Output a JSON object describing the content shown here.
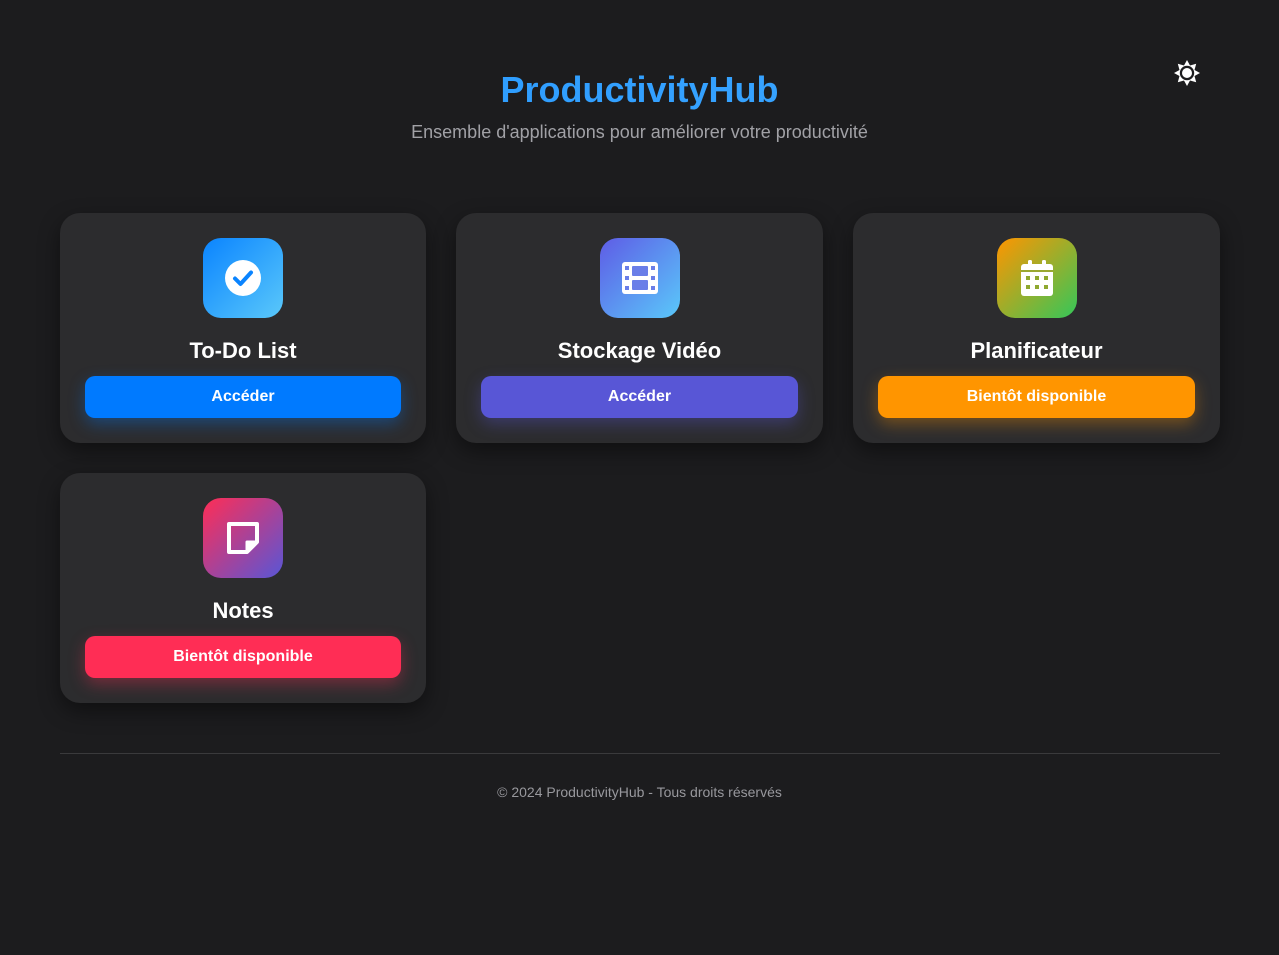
{
  "app": {
    "title": "ProductivityHub",
    "subtitle": "Ensemble d'applications pour améliorer votre productivité"
  },
  "theme_toggle": {
    "icon": "sun-icon"
  },
  "cards": [
    {
      "title": "To-Do List",
      "button_label": "Accéder",
      "icon": "check-circle-icon",
      "icon_gradient": [
        "#0a84ff",
        "#5ac8fa"
      ],
      "button_color": "#007aff"
    },
    {
      "title": "Stockage Vidéo",
      "button_label": "Accéder",
      "icon": "film-icon",
      "icon_gradient": [
        "#5e5ce6",
        "#5ac8fa"
      ],
      "button_color": "#5856d6"
    },
    {
      "title": "Planificateur",
      "button_label": "Bientôt disponible",
      "icon": "calendar-icon",
      "icon_gradient": [
        "#ff9500",
        "#34c759"
      ],
      "button_color": "#ff9500"
    },
    {
      "title": "Notes",
      "button_label": "Bientôt disponible",
      "icon": "sticky-note-icon",
      "icon_gradient": [
        "#ff2d55",
        "#5856d6"
      ],
      "button_color": "#ff2d55"
    }
  ],
  "footer": {
    "text": "© 2024 ProductivityHub - Tous droits réservés"
  }
}
